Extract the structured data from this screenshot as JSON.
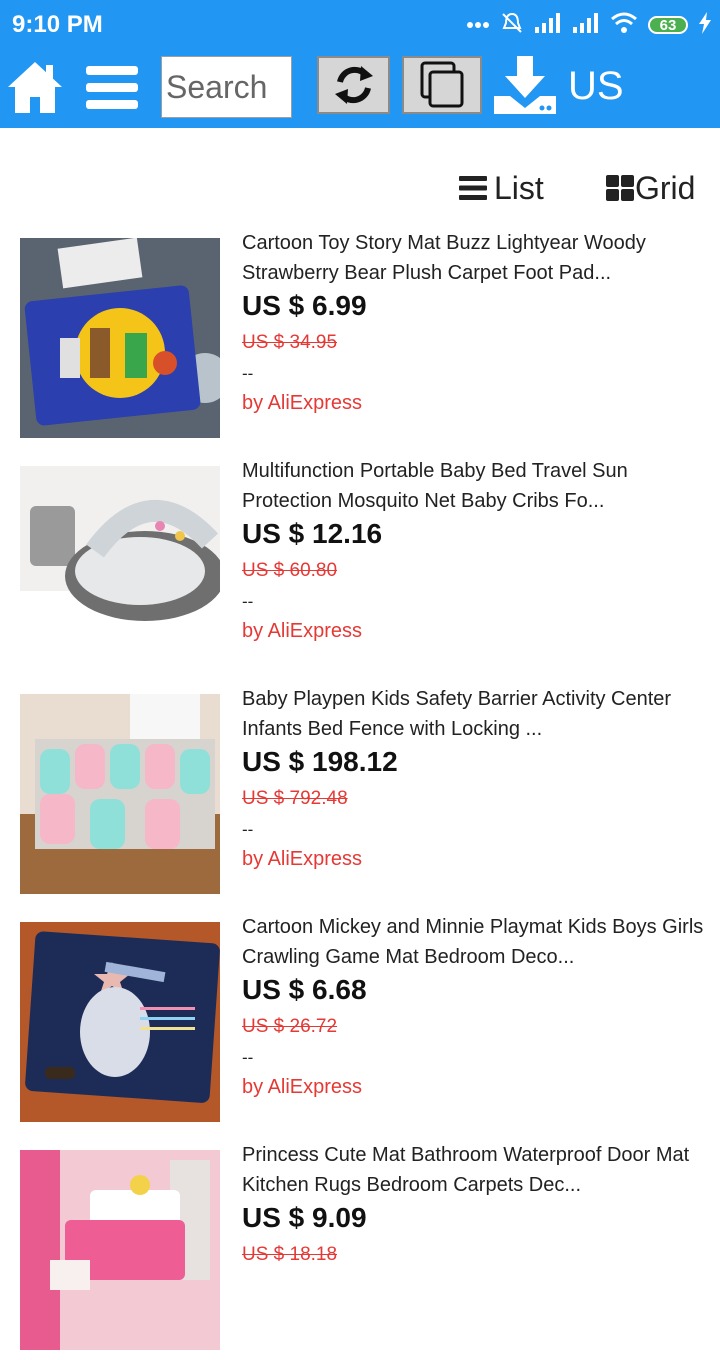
{
  "status_bar": {
    "time": "9:10 PM",
    "battery": "63"
  },
  "toolbar": {
    "search_placeholder": "Search",
    "region": "US",
    "icons": [
      "home-icon",
      "menu-icon",
      "refresh-icon",
      "copy-icon",
      "download-icon"
    ]
  },
  "view_switch": {
    "list_label": "List",
    "grid_label": "Grid"
  },
  "colors": {
    "primary": "#2196f3",
    "sale_red": "#e53935"
  },
  "products": [
    {
      "title": "Cartoon Toy Story Mat Buzz Lightyear Woody Strawberry Bear Plush Carpet Foot Pad...",
      "price": "US $ 6.99",
      "original_price": "US $ 34.95",
      "rating": "--",
      "seller": "by AliExpress"
    },
    {
      "title": "Multifunction Portable Baby Bed Travel Sun Protection Mosquito Net Baby Cribs Fo...",
      "price": "US $ 12.16",
      "original_price": "US $ 60.80",
      "rating": "--",
      "seller": "by AliExpress"
    },
    {
      "title": "Baby Playpen Kids Safety Barrier Activity Center Infants Bed Fence with Locking ...",
      "price": "US $ 198.12",
      "original_price": "US $ 792.48",
      "rating": "--",
      "seller": "by AliExpress"
    },
    {
      "title": "Cartoon Mickey and Minnie Playmat Kids Boys Girls Crawling Game Mat Bedroom Deco...",
      "price": "US $ 6.68",
      "original_price": "US $ 26.72",
      "rating": "--",
      "seller": "by AliExpress"
    },
    {
      "title": "Princess Cute Mat Bathroom Waterproof Door Mat Kitchen Rugs Bedroom Carpets Dec...",
      "price": "US $ 9.09",
      "original_price": "US $ 18.18",
      "rating": "",
      "seller": ""
    }
  ]
}
